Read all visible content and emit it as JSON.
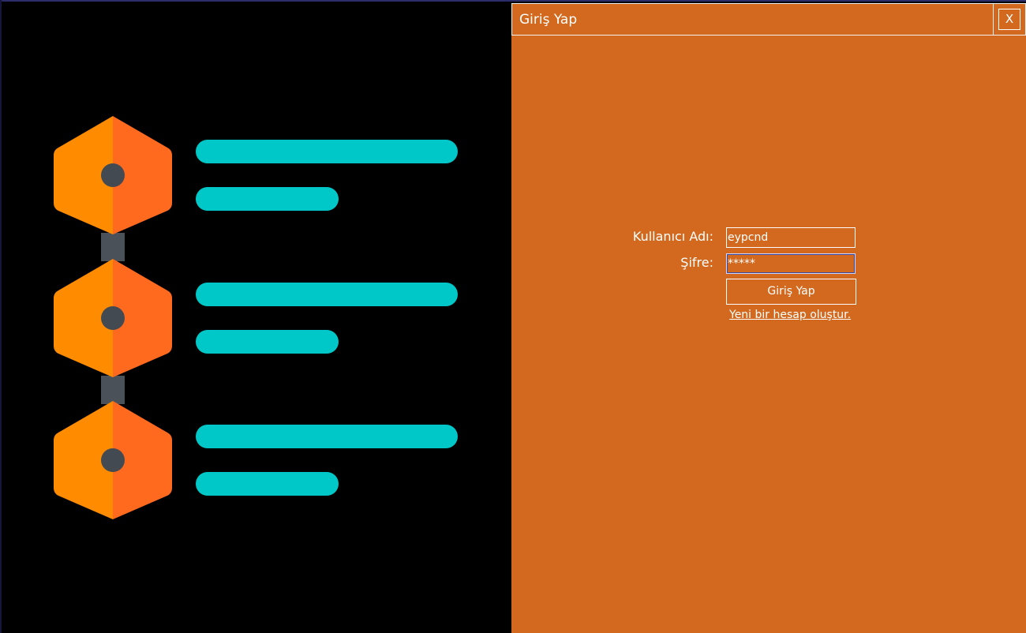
{
  "window": {
    "title": "Giriş Yap",
    "close_label": "X"
  },
  "login_form": {
    "username_label": "Kullanıcı Adı:",
    "username_value": "eypcnd",
    "password_label": "Şifre:",
    "password_value": "*****",
    "submit_label": "Giriş Yap",
    "signup_link": "Yeni bir hesap oluştur."
  },
  "colors": {
    "panel_background": "#d2691e",
    "illustration_background": "#000000",
    "hexagon_left": "#ff8c00",
    "hexagon_right": "#ff6a1f",
    "connector": "#4b5158",
    "bar": "#00c8c8"
  },
  "illustration": {
    "icons": [
      "hexagon-node-icon",
      "hexagon-node-icon",
      "hexagon-node-icon"
    ],
    "rows": 3
  }
}
